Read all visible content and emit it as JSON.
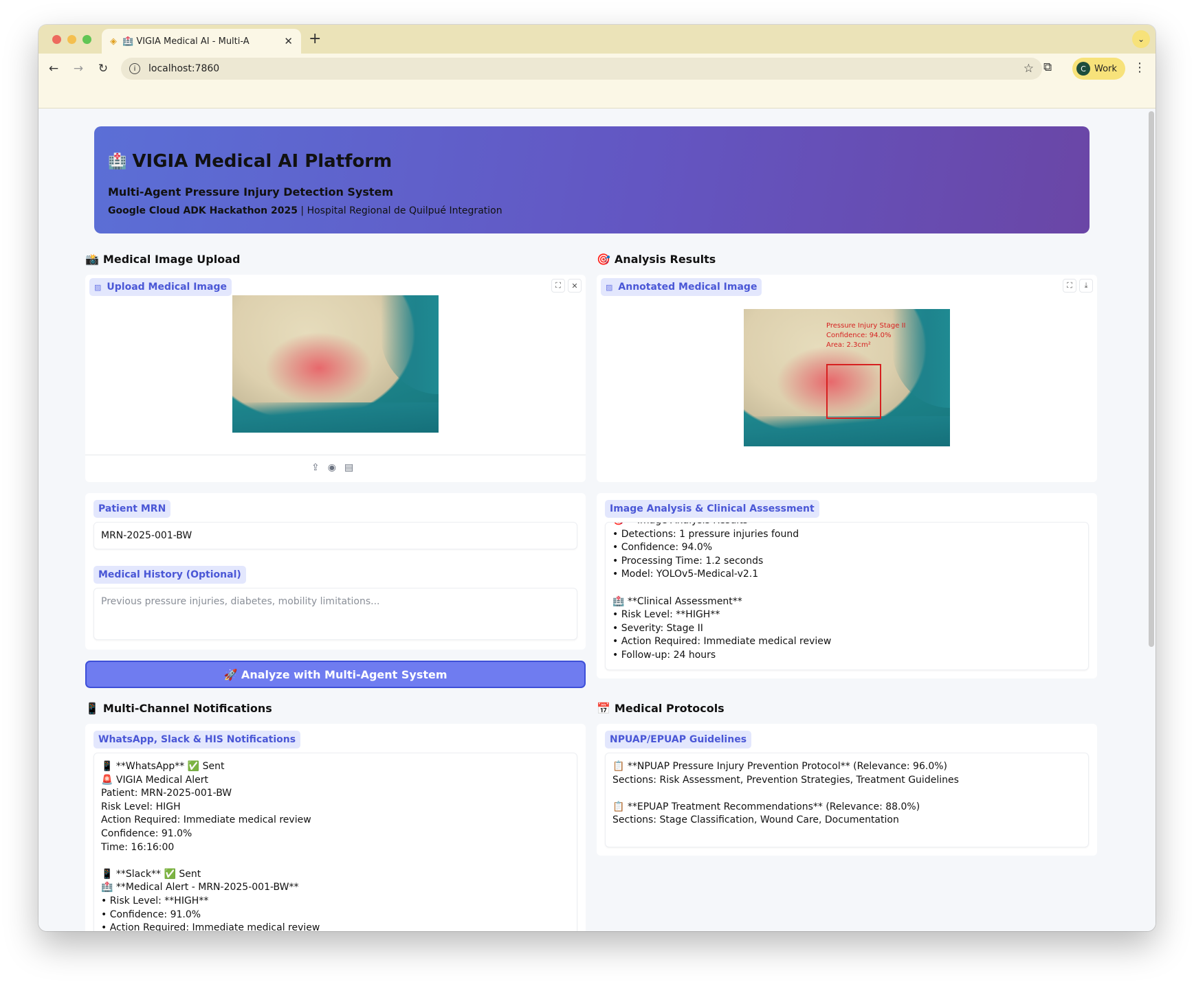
{
  "browser": {
    "tab_title": "🏥 VIGIA Medical AI - Multi-A",
    "url": "localhost:7860",
    "profile_initial": "C",
    "profile_name": "Work"
  },
  "hero": {
    "title": "VIGIA Medical AI Platform",
    "subtitle": "Multi-Agent Pressure Injury Detection System",
    "event": "Google Cloud ADK Hackathon 2025",
    "separator": " | ",
    "integration": "Hospital Regional de Quilpué Integration"
  },
  "upload_section": {
    "title": "Medical Image Upload",
    "image_label": "Upload Medical Image"
  },
  "results_section": {
    "title": "Analysis Results",
    "image_label": "Annotated Medical Image",
    "annotation": [
      "Pressure Injury Stage II",
      "Confidence: 94.0%",
      "Area: 2.3cm²"
    ]
  },
  "patient": {
    "mrn_label": "Patient MRN",
    "mrn_value": "MRN-2025-001-BW",
    "history_label": "Medical History (Optional)",
    "history_placeholder": "Previous pressure injuries, diabetes, mobility limitations..."
  },
  "analyze_button": "🚀 Analyze with Multi-Agent System",
  "assessment": {
    "label": "Image Analysis & Clinical Assessment",
    "lines": [
      "🎯 **Image Analysis Results**",
      "• Detections: 1 pressure injuries found",
      "• Confidence: 94.0%",
      "• Processing Time: 1.2 seconds",
      "• Model: YOLOv5-Medical-v2.1",
      "",
      "🏥 **Clinical Assessment**",
      "• Risk Level: **HIGH**",
      "• Severity: Stage II",
      "• Action Required: Immediate medical review",
      "• Follow-up: 24 hours"
    ]
  },
  "notifications": {
    "title": "Multi-Channel Notifications",
    "label": "WhatsApp, Slack & HIS Notifications",
    "lines": [
      "📱 **WhatsApp** ✅ Sent",
      "🚨 VIGIA Medical Alert",
      "Patient: MRN-2025-001-BW",
      "Risk Level: HIGH",
      "Action Required: Immediate medical review",
      "Confidence: 91.0%",
      "Time: 16:16:00",
      "",
      "📱 **Slack** ✅ Sent",
      "🏥 **Medical Alert - MRN-2025-001-BW**",
      "• Risk Level: **HIGH**",
      "• Confidence: 91.0%",
      "• Action Required: Immediate medical review"
    ]
  },
  "protocols": {
    "title": "Medical Protocols",
    "label": "NPUAP/EPUAP Guidelines",
    "lines": [
      "📋 **NPUAP Pressure Injury Prevention Protocol** (Relevance: 96.0%)",
      "Sections: Risk Assessment, Prevention Strategies, Treatment Guidelines",
      "",
      "📋 **EPUAP Treatment Recommendations** (Relevance: 88.0%)",
      "Sections: Stage Classification, Wound Care, Documentation"
    ]
  },
  "icons": {
    "section_upload": "camera-icon",
    "section_results": "target-icon",
    "section_notifications": "phone-icon",
    "section_protocols": "calendar-icon"
  },
  "colors": {
    "hero_start": "#5b6fd6",
    "hero_end": "#6a46a6",
    "chip_bg": "#e3e7fd",
    "chip_text": "#4a57d6",
    "button": "#6f7cf0",
    "annotation": "#d62020"
  }
}
